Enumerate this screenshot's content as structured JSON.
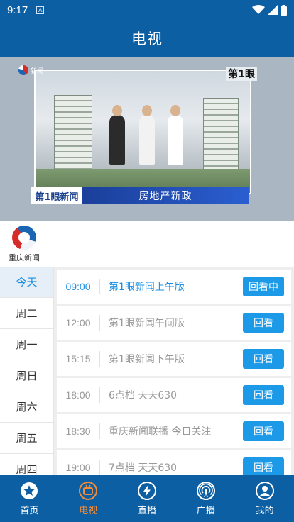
{
  "status_bar": {
    "time": "9:17",
    "notification_badge": "A",
    "icons": [
      "wifi-icon",
      "signal-icon",
      "battery-icon"
    ]
  },
  "app_bar": {
    "title": "电视"
  },
  "player": {
    "logo_top_left": "新闻",
    "logo_top_right": "第1眼",
    "lower_third_logo": "第1眼新闻",
    "lower_third_title": "房地产新政"
  },
  "channel": {
    "name": "重庆新闻",
    "logo_icon": "cq-news-logo-icon"
  },
  "days": [
    "今天",
    "周二",
    "周一",
    "周日",
    "周六",
    "周五",
    "周四"
  ],
  "active_day_index": 0,
  "programs": [
    {
      "time": "09:00",
      "title": "第1眼新闻上午版",
      "button": "回看中",
      "current": true
    },
    {
      "time": "12:00",
      "title": "第1眼新闻午间版",
      "button": "回看",
      "current": false
    },
    {
      "time": "15:15",
      "title": "第1眼新闻下午版",
      "button": "回看",
      "current": false
    },
    {
      "time": "18:00",
      "title": "6点档 天天630",
      "button": "回看",
      "current": false
    },
    {
      "time": "18:30",
      "title": "重庆新闻联播 今日关注",
      "button": "回看",
      "current": false
    },
    {
      "time": "19:00",
      "title": "7点档 天天630",
      "button": "回看",
      "current": false
    }
  ],
  "tabs": [
    {
      "label": "首页",
      "icon": "star-icon"
    },
    {
      "label": "电视",
      "icon": "tv-icon",
      "active": true
    },
    {
      "label": "直播",
      "icon": "lightning-icon"
    },
    {
      "label": "广播",
      "icon": "radio-signal-icon"
    },
    {
      "label": "我的",
      "icon": "user-icon"
    }
  ],
  "colors": {
    "primary": "#0d5fa3",
    "accent": "#1c9ae8",
    "tab_active": "#f08c3a"
  }
}
